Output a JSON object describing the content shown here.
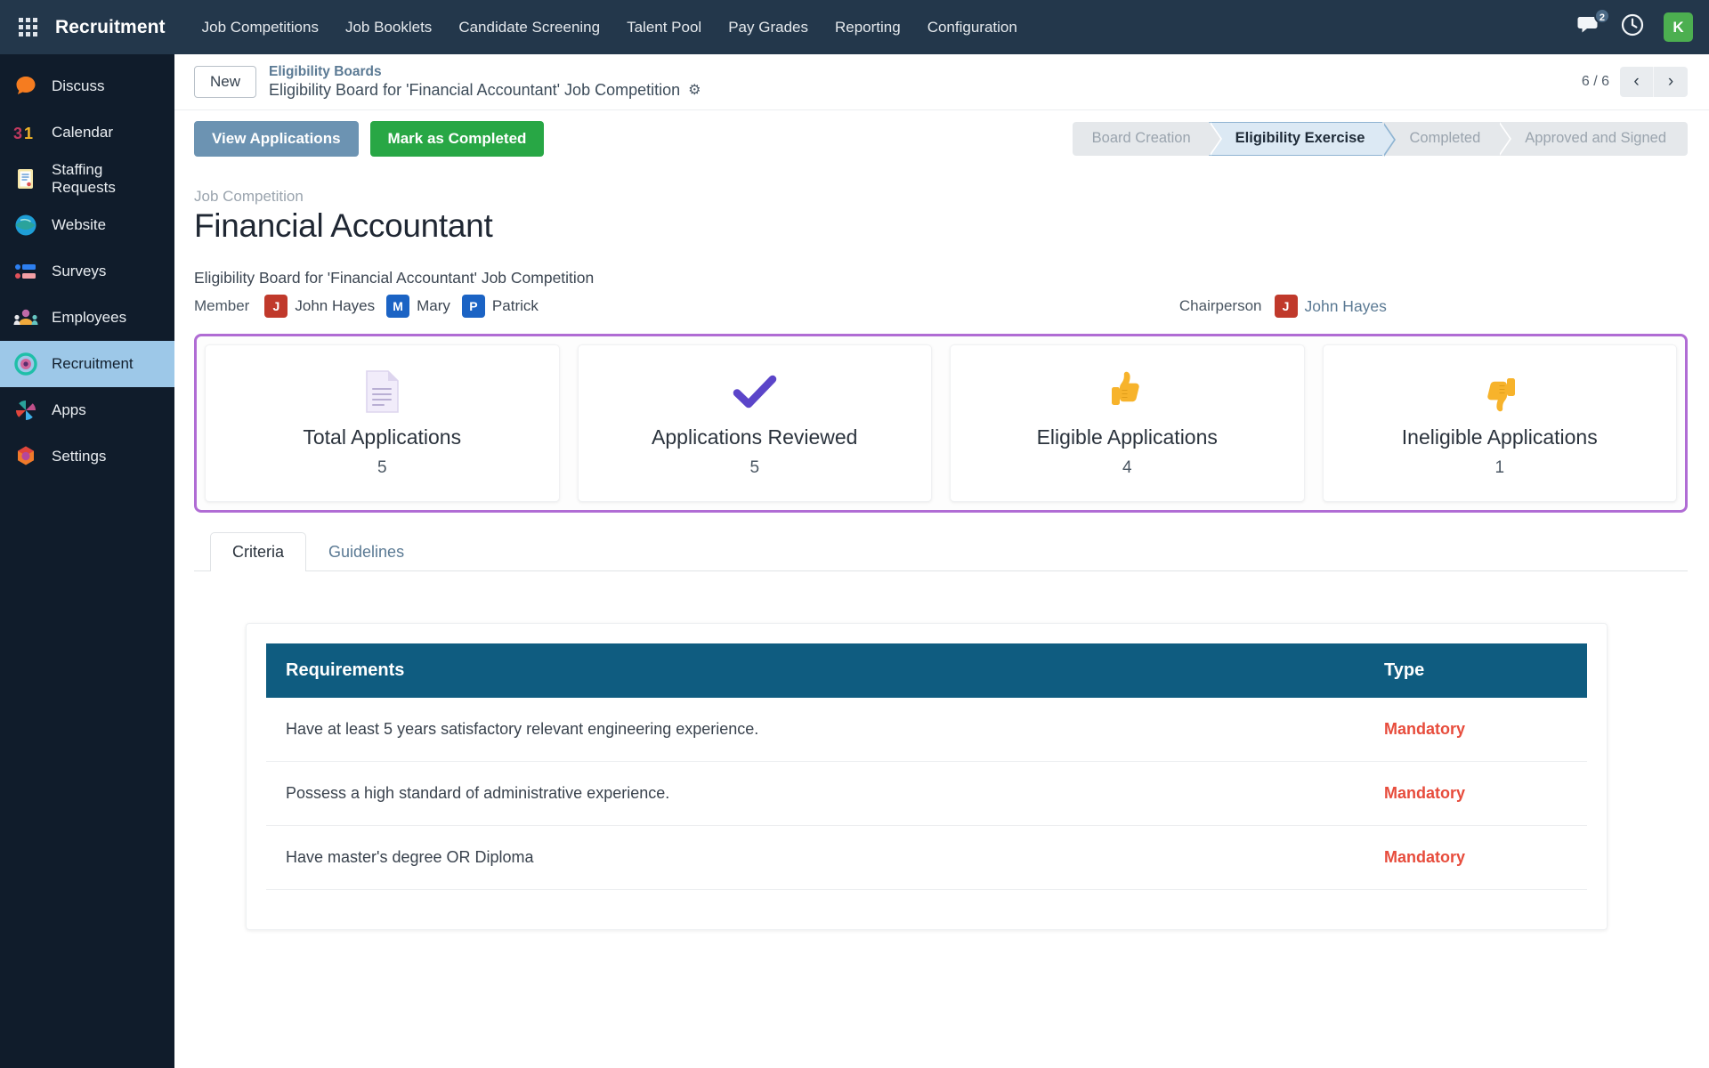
{
  "navbar": {
    "apps_icon": "apps-grid-icon",
    "brand": "Recruitment",
    "menu": [
      "Job Competitions",
      "Job Booklets",
      "Candidate Screening",
      "Talent Pool",
      "Pay Grades",
      "Reporting",
      "Configuration"
    ],
    "messages_icon": "messages-icon",
    "messages_count": "2",
    "activity_icon": "clock-icon",
    "user_initial": "K",
    "accent": "#23374b",
    "avatar_color": "#4caf50"
  },
  "sidebar": {
    "items": [
      {
        "label": "Discuss",
        "icon": "discuss-icon"
      },
      {
        "label": "Calendar",
        "icon": "calendar-icon"
      },
      {
        "label": "Staffing Requests",
        "icon": "clipboard-icon"
      },
      {
        "label": "Website",
        "icon": "website-icon"
      },
      {
        "label": "Surveys",
        "icon": "surveys-icon"
      },
      {
        "label": "Employees",
        "icon": "employees-icon"
      },
      {
        "label": "Recruitment",
        "icon": "recruitment-icon",
        "active": true
      },
      {
        "label": "Apps",
        "icon": "apps-icon"
      },
      {
        "label": "Settings",
        "icon": "settings-icon"
      }
    ]
  },
  "breadcrumb": {
    "new_button": "New",
    "parent": "Eligibility Boards",
    "current": "Eligibility Board for 'Financial Accountant' Job Competition",
    "gear_icon": "gear-icon",
    "pager": "6 / 6",
    "prev_icon": "chevron-left-icon",
    "next_icon": "chevron-right-icon"
  },
  "actions": {
    "view_applications": "View Applications",
    "mark_completed": "Mark as Completed",
    "view_color": "#6c93b2",
    "mark_color": "#28a745"
  },
  "statusbar": {
    "stages": [
      {
        "label": "Board Creation",
        "state": "done"
      },
      {
        "label": "Eligibility Exercise",
        "state": "current"
      },
      {
        "label": "Completed",
        "state": "todo"
      },
      {
        "label": "Approved and Signed",
        "state": "todo"
      }
    ]
  },
  "record": {
    "label": "Job Competition",
    "title": "Financial Accountant",
    "description": "Eligibility Board for 'Financial Accountant' Job Competition",
    "member_label": "Member",
    "members": [
      {
        "initial": "J",
        "name": "John Hayes",
        "color": "red"
      },
      {
        "initial": "M",
        "name": "Mary",
        "color": "blue"
      },
      {
        "initial": "P",
        "name": "Patrick",
        "color": "blue"
      }
    ],
    "chairperson_label": "Chairperson",
    "chairperson": {
      "initial": "J",
      "name": "John Hayes",
      "color": "red"
    }
  },
  "stats": {
    "highlight_color": "#b06cd4",
    "cards": [
      {
        "icon": "document-icon",
        "name": "Total Applications",
        "value": "5"
      },
      {
        "icon": "check-icon",
        "name": "Applications Reviewed",
        "value": "5"
      },
      {
        "icon": "thumbs-up-icon",
        "name": "Eligible Applications",
        "value": "4"
      },
      {
        "icon": "thumbs-down-icon",
        "name": "Ineligible Applications",
        "value": "1"
      }
    ]
  },
  "tabs": [
    {
      "label": "Criteria",
      "active": true
    },
    {
      "label": "Guidelines",
      "active": false
    }
  ],
  "criteria_table": {
    "header_color": "#0f5c80",
    "columns": [
      "Requirements",
      "Type"
    ],
    "rows": [
      {
        "requirement": "Have at least 5 years satisfactory relevant engineering experience.",
        "type": "Mandatory"
      },
      {
        "requirement": "Possess a high standard of administrative experience.",
        "type": "Mandatory"
      },
      {
        "requirement": "Have master's degree OR Diploma",
        "type": "Mandatory"
      }
    ]
  }
}
